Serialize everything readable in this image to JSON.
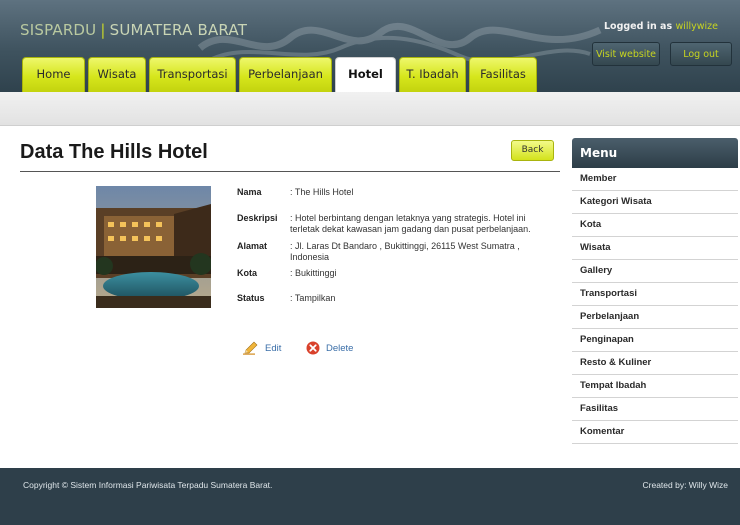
{
  "header": {
    "brand_part1": "SISPARDU",
    "brand_separator": "|",
    "brand_part2": "SUMATERA BARAT",
    "logged_in_prefix": "Logged in as",
    "username": "willywize",
    "visit_label": "Visit website",
    "logout_label": "Log out"
  },
  "tabs": [
    {
      "label": "Home",
      "active": false
    },
    {
      "label": "Wisata",
      "active": false
    },
    {
      "label": "Transportasi",
      "active": false
    },
    {
      "label": "Perbelanjaan",
      "active": false
    },
    {
      "label": "Hotel",
      "active": true
    },
    {
      "label": "T. Ibadah",
      "active": false
    },
    {
      "label": "Fasilitas",
      "active": false
    }
  ],
  "main": {
    "title": "Data The Hills Hotel",
    "back_label": "Back",
    "fields": [
      {
        "label": "Nama",
        "value": ": The Hills Hotel"
      },
      {
        "label": "Deskripsi",
        "value": ": Hotel berbintang dengan letaknya yang strategis. Hotel ini terletak dekat kawasan jam gadang dan pusat perbelanjaan."
      },
      {
        "label": "Alamat",
        "value": ": Jl. Laras Dt Bandaro , Bukittinggi, 26115 West Sumatra , Indonesia"
      },
      {
        "label": "Kota",
        "value": ": Bukittinggi"
      },
      {
        "label": "Status",
        "value": ": Tampilkan"
      }
    ],
    "edit_label": "Edit",
    "delete_label": "Delete",
    "photo_icon": "hotel-photo"
  },
  "sidebar": {
    "title": "Menu",
    "items": [
      "Member",
      "Kategori Wisata",
      "Kota",
      "Wisata",
      "Gallery",
      "Transportasi",
      "Perbelanjaan",
      "Penginapan",
      "Resto & Kuliner",
      "Tempat Ibadah",
      "Fasilitas",
      "Komentar"
    ]
  },
  "footer": {
    "copyright": "Copyright © Sistem Informasi Pariwisata Terpadu Sumatera Barat.",
    "created_by": "Created by: Willy Wize"
  },
  "colors": {
    "tab_accent": "#d6e61c",
    "header_dark": "#3f535f",
    "footer_bg": "#2e3f4a",
    "username_color": "#c7d420"
  }
}
